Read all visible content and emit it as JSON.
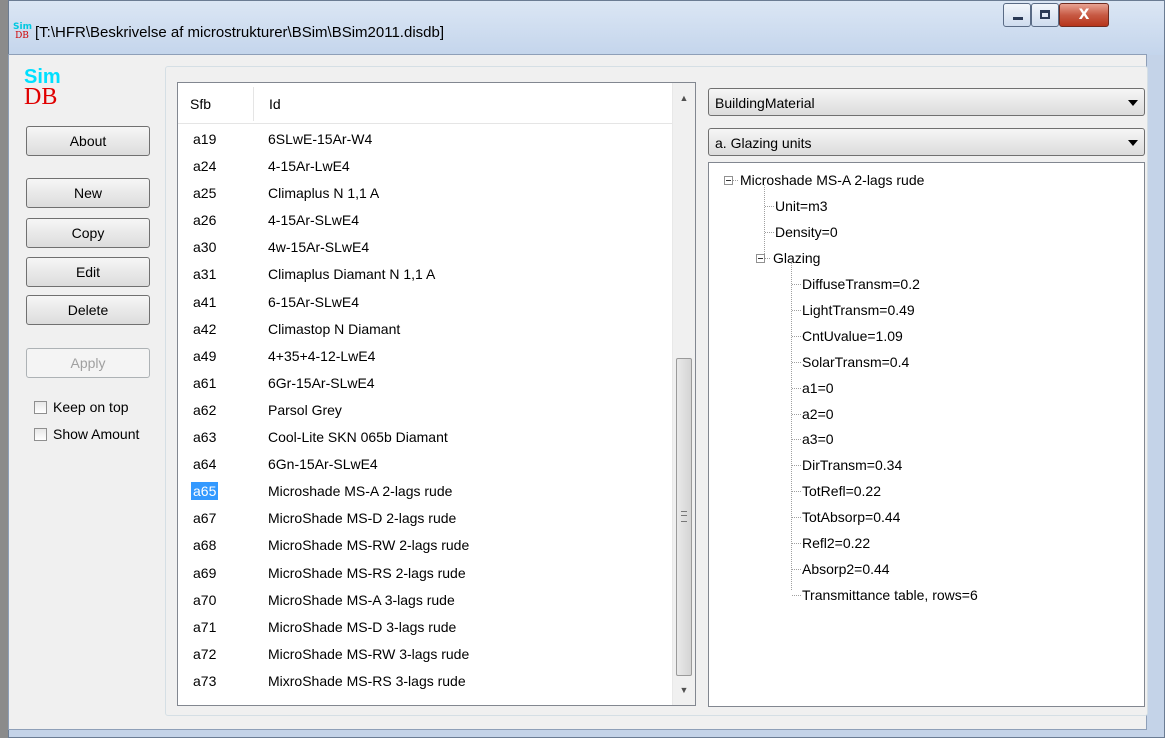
{
  "window": {
    "title": "[T:\\HFR\\Beskrivelse af microstrukturer\\BSim\\BSim2011.disdb]",
    "icon_sim": "Sim",
    "icon_db": "DB",
    "close_glyph": "X"
  },
  "logo": {
    "sim": "Sim",
    "db": "DB"
  },
  "buttons": {
    "about": "About",
    "new": "New",
    "copy": "Copy",
    "edit": "Edit",
    "delete": "Delete",
    "apply": "Apply"
  },
  "checkboxes": {
    "keep_on_top": "Keep on top",
    "show_amount": "Show Amount"
  },
  "list": {
    "headers": [
      "Sfb",
      "Id"
    ],
    "selected_index": 13,
    "rows": [
      {
        "sfb": "a19",
        "id": "6SLwE-15Ar-W4"
      },
      {
        "sfb": "a24",
        "id": "4-15Ar-LwE4"
      },
      {
        "sfb": "a25",
        "id": "Climaplus N 1,1 A"
      },
      {
        "sfb": "a26",
        "id": "4-15Ar-SLwE4"
      },
      {
        "sfb": "a30",
        "id": "4w-15Ar-SLwE4"
      },
      {
        "sfb": "a31",
        "id": "Climaplus Diamant N 1,1 A"
      },
      {
        "sfb": "a41",
        "id": "6-15Ar-SLwE4"
      },
      {
        "sfb": "a42",
        "id": "Climastop N Diamant"
      },
      {
        "sfb": "a49",
        "id": "4+35+4-12-LwE4"
      },
      {
        "sfb": "a61",
        "id": "6Gr-15Ar-SLwE4"
      },
      {
        "sfb": "a62",
        "id": "Parsol Grey"
      },
      {
        "sfb": "a63",
        "id": "Cool-Lite SKN 065b Diamant"
      },
      {
        "sfb": "a64",
        "id": "6Gn-15Ar-SLwE4"
      },
      {
        "sfb": "a65",
        "id": "Microshade MS-A 2-lags rude"
      },
      {
        "sfb": "a67",
        "id": "MicroShade MS-D 2-lags rude"
      },
      {
        "sfb": "a68",
        "id": "MicroShade MS-RW 2-lags rude"
      },
      {
        "sfb": "a69",
        "id": "MicroShade MS-RS 2-lags rude"
      },
      {
        "sfb": "a70",
        "id": "MicroShade MS-A 3-lags rude"
      },
      {
        "sfb": "a71",
        "id": "MicroShade MS-D 3-lags rude"
      },
      {
        "sfb": "a72",
        "id": "MicroShade MS-RW 3-lags rude"
      },
      {
        "sfb": "a73",
        "id": "MixroShade MS-RS 3-lags rude"
      }
    ]
  },
  "combos": {
    "type": "BuildingMaterial",
    "category": "a. Glazing units"
  },
  "tree": {
    "root": "Microshade MS-A 2-lags rude",
    "unit": "Unit=m3",
    "density": "Density=0",
    "glazing": "Glazing",
    "glazing_children": [
      "DiffuseTransm=0.2",
      "LightTransm=0.49",
      "CntUvalue=1.09",
      "SolarTransm=0.4",
      "a1=0",
      "a2=0",
      "a3=0",
      "DirTransm=0.34",
      "TotRefl=0.22",
      "TotAbsorp=0.44",
      "Refl2=0.22",
      "Absorp2=0.44",
      "Transmittance table, rows=6"
    ]
  }
}
